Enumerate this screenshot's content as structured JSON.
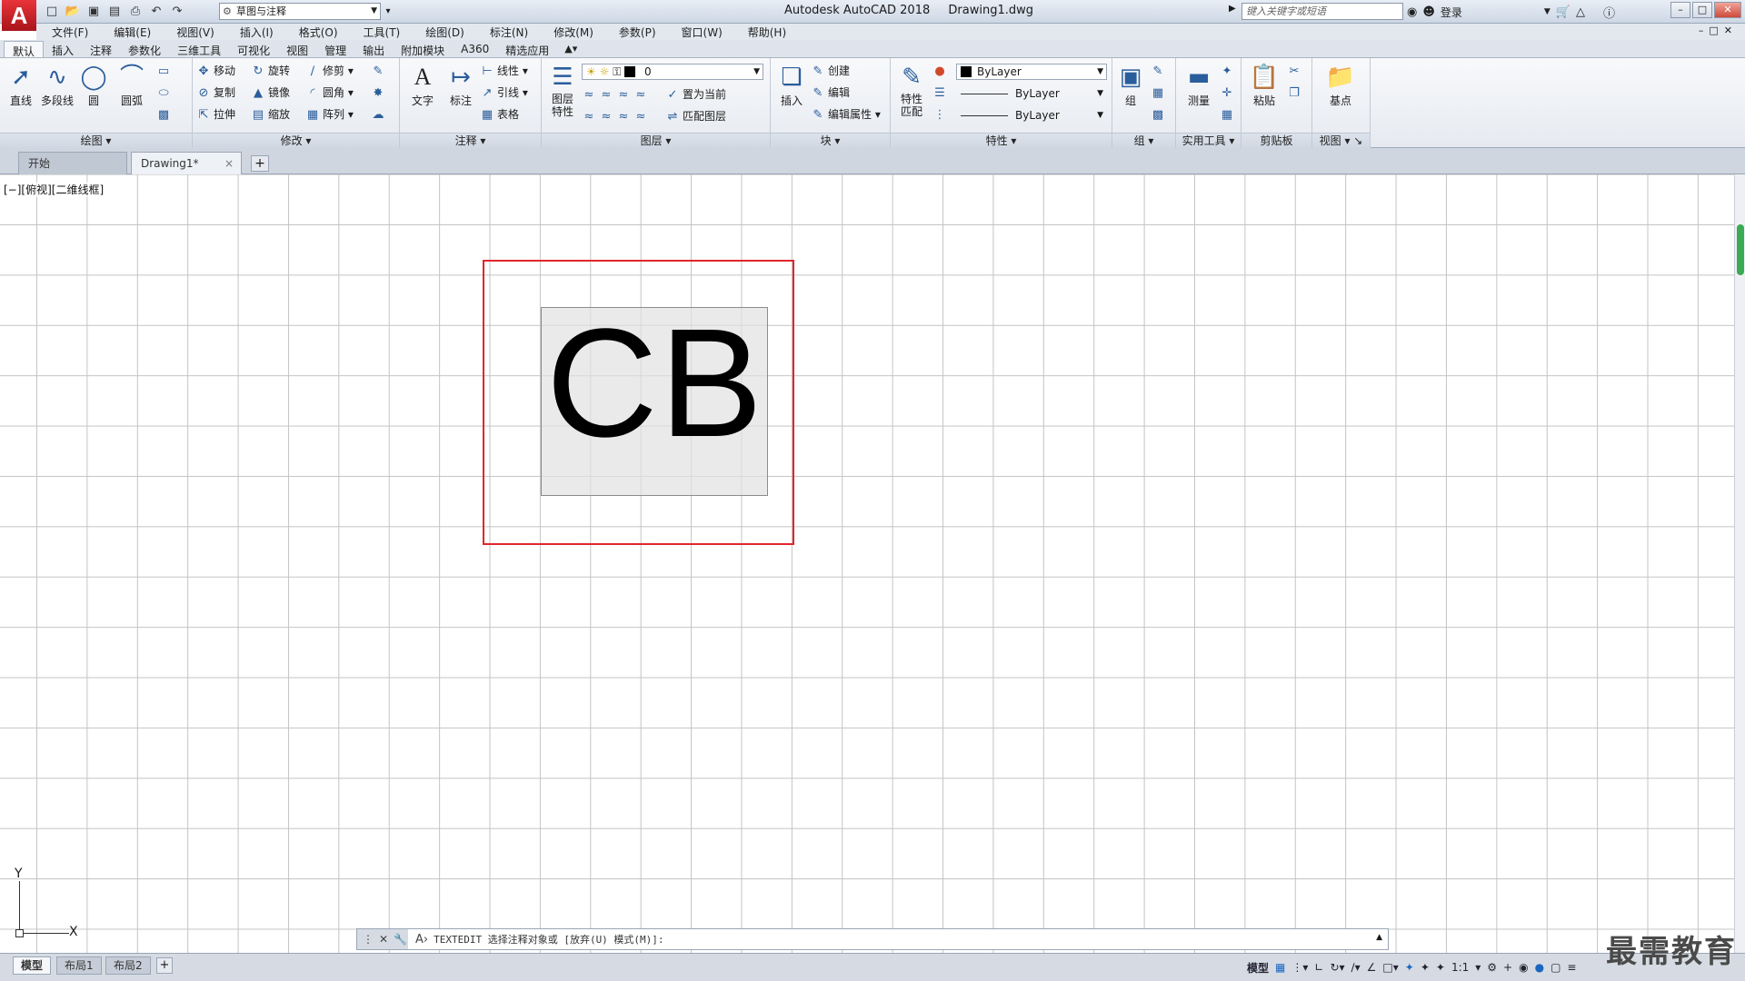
{
  "app": {
    "logo_letter": "A",
    "title": "Autodesk AutoCAD 2018",
    "file": "Drawing1.dwg"
  },
  "qat": {
    "icons": [
      "new-file-icon",
      "open-icon",
      "save-icon",
      "saveas-icon",
      "print-icon",
      "undo-icon",
      "redo-icon"
    ],
    "workspace": "草图与注释"
  },
  "header": {
    "search_placeholder": "键入关键字或短语",
    "login": "登录"
  },
  "menu": [
    "文件(F)",
    "编辑(E)",
    "视图(V)",
    "插入(I)",
    "格式(O)",
    "工具(T)",
    "绘图(D)",
    "标注(N)",
    "修改(M)",
    "参数(P)",
    "窗口(W)",
    "帮助(H)"
  ],
  "ribbon_tabs": [
    "默认",
    "插入",
    "注释",
    "参数化",
    "三维工具",
    "可视化",
    "视图",
    "管理",
    "输出",
    "附加模块",
    "A360",
    "精选应用"
  ],
  "ribbon": {
    "draw": {
      "title": "绘图",
      "line": "直线",
      "polyline": "多段线",
      "circle": "圆",
      "arc": "圆弧"
    },
    "modify": {
      "title": "修改",
      "move": "移动",
      "rotate": "旋转",
      "trim": "修剪",
      "copy": "复制",
      "mirror": "镜像",
      "fillet": "圆角",
      "stretch": "拉伸",
      "scale": "缩放",
      "array": "阵列"
    },
    "annotation": {
      "title": "注释",
      "text": "文字",
      "dimension": "标注",
      "linear": "线性",
      "leader": "引线",
      "table": "表格"
    },
    "layers": {
      "title": "图层",
      "props": "图层特性",
      "current": "0",
      "set_current": "置为当前",
      "match_layer": "匹配图层"
    },
    "block": {
      "title": "块",
      "insert": "插入",
      "create": "创建",
      "edit": "编辑",
      "edit_attr": "编辑属性"
    },
    "properties": {
      "title": "特性",
      "match": "特性匹配",
      "color": "ByLayer",
      "linetype": "ByLayer",
      "lineweight": "ByLayer"
    },
    "groups": {
      "title": "组",
      "group": "组"
    },
    "utilities": {
      "title": "实用工具",
      "measure": "测量"
    },
    "clipboard": {
      "title": "剪贴板",
      "paste": "粘贴"
    },
    "view": {
      "title": "视图",
      "base": "基点"
    }
  },
  "doc_tabs": {
    "start": "开始",
    "drawing": "Drawing1*"
  },
  "viewport": {
    "control": "[−][俯视][二维线框]",
    "mtext": "CB",
    "ucs_x": "X",
    "ucs_y": "Y"
  },
  "command": {
    "prompt_text": "TEXTEDIT 选择注释对象或 [放弃(U) 模式(M)]:"
  },
  "layout_tabs": [
    "模型",
    "布局1",
    "布局2"
  ],
  "status": {
    "model": "模型",
    "scale": "1:1"
  },
  "watermark": "最需教育",
  "colors": {
    "accent": "#1b67c0",
    "selection": "#e0262b",
    "logo": "#c8232a"
  }
}
